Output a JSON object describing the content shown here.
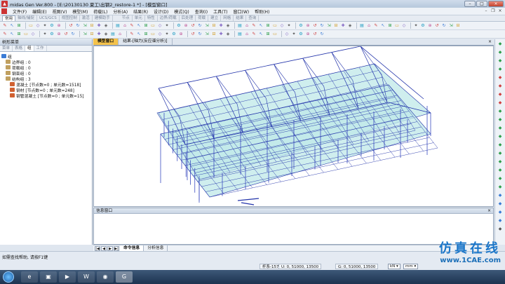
{
  "window": {
    "title": "midas Gen Ver.800 - [E:\\20130130 夏工\\出钢2_restore-1 *] - [模型窗口]"
  },
  "menu": {
    "items": [
      "文件(F)",
      "编辑(E)",
      "视图(V)",
      "模型(M)",
      "荷载(L)",
      "分析(A)",
      "结果(R)",
      "设计(D)",
      "模式(Q)",
      "查询(I)",
      "工具(T)",
      "窗口(W)",
      "帮助(H)"
    ]
  },
  "ribbon_tabs": [
    "常用",
    "轴线/捕捉",
    "UCS/GCS",
    "视图控制",
    "激活",
    "建模助手",
    "节点",
    "单元",
    "特性",
    "边界/荷载",
    "后处理",
    "荷载",
    "建立",
    "网格",
    "结果",
    "查询"
  ],
  "ribbon_active": "常用",
  "left_panel": {
    "title": "树形菜单",
    "tabs": [
      "菜单",
      "表格",
      "组",
      "工作"
    ],
    "active_tab": "组",
    "tree": [
      {
        "label": "组",
        "level": 0,
        "color": "#3a7bd5"
      },
      {
        "label": "边界组 : 0",
        "level": 1,
        "color": "#c0a060"
      },
      {
        "label": "荷载组 : 0",
        "level": 1,
        "color": "#c0a060"
      },
      {
        "label": "钢束组 : 0",
        "level": 1,
        "color": "#c0a060"
      },
      {
        "label": "结构组 : 3",
        "level": 1,
        "color": "#c0a060"
      },
      {
        "label": "混凝土 [节点数=0 ; 单元数=1518]",
        "level": 2,
        "color": "#d06030"
      },
      {
        "label": "钢材 [节点数=0 ; 单元数=248]",
        "level": 2,
        "color": "#d06030"
      },
      {
        "label": "钢管混凝土 [节点数=0 ; 单元数=15]",
        "level": 2,
        "color": "#d06030"
      }
    ]
  },
  "view_tabs": [
    "模型窗口",
    "结果-[轴力(反应谱分析)]"
  ],
  "view_active": "模型窗口",
  "info_window": {
    "title": "信息窗口"
  },
  "info_tabs": [
    "命令信息",
    "分析信息"
  ],
  "info_active": "命令信息",
  "status": {
    "help": "如需查找帮助, 请按F1键",
    "node": "杆系-1579",
    "u": "U: 0, 51000, 13500",
    "g": "G: 0, 51000, 13500",
    "force_unit": "kN",
    "length_unit": "mm"
  },
  "colors": {
    "frame": "#2233aa",
    "slab": "#bfe8e8",
    "column": "#3b4cc0"
  },
  "watermark": {
    "cn": "仿真在线",
    "url": "www.1CAE.com"
  }
}
